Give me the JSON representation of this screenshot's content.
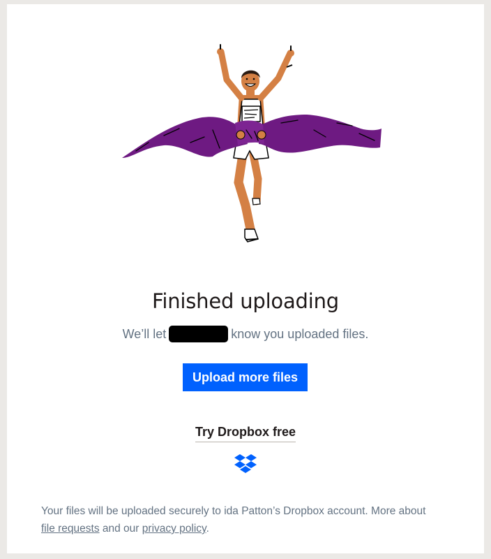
{
  "hero": {
    "illustration": "runner-crossing-finish-line-ribbon"
  },
  "heading": {
    "title": "Finished uploading",
    "subtitle_prefix": "We’ll let",
    "subtitle_suffix": "know you uploaded files."
  },
  "actions": {
    "upload_more_label": "Upload more files",
    "try_dropbox_label": "Try Dropbox free"
  },
  "brand": {
    "logo_icon": "dropbox-logo-icon",
    "color": "#0061fe"
  },
  "footer": {
    "text_before": "Your files will be uploaded securely to ida Patton’s Dropbox account. More about",
    "file_requests_link": "file requests",
    "middle": "and our",
    "privacy_link": "privacy policy",
    "end": "."
  }
}
